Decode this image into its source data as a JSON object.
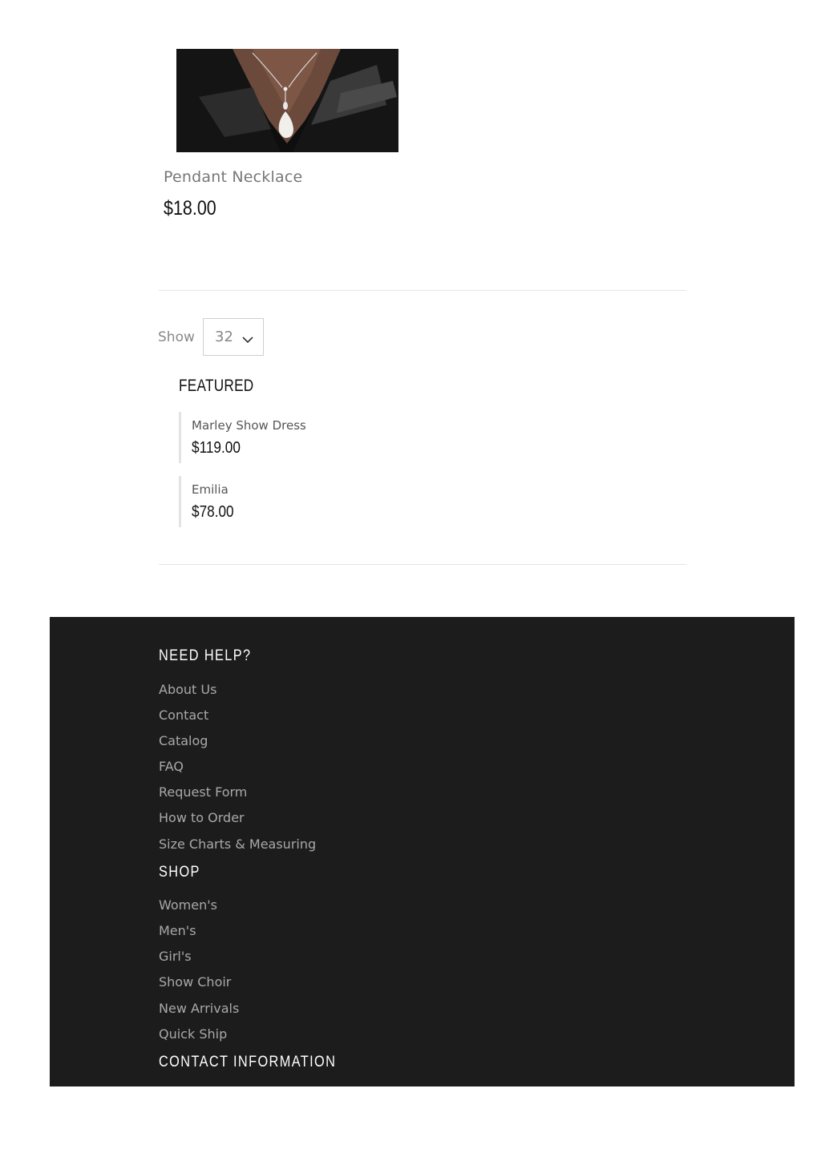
{
  "product": {
    "name": "Pendant Necklace",
    "price": "$18.00",
    "image": "necklace-photo"
  },
  "pagination": {
    "show_label": "Show",
    "per_page": "32"
  },
  "featured": {
    "title": "FEATURED",
    "items": [
      {
        "name": "Marley Show Dress",
        "price": "$119.00"
      },
      {
        "name": "Emilia",
        "price": "$78.00"
      }
    ]
  },
  "footer": {
    "need_help": {
      "title": "NEED HELP?",
      "links": [
        "About Us",
        "Contact",
        "Catalog",
        "FAQ",
        "Request Form",
        "How to Order",
        "Size Charts & Measuring"
      ]
    },
    "shop": {
      "title": "SHOP",
      "links": [
        "Women's",
        "Men's",
        "Girl's",
        "Show Choir",
        "New Arrivals",
        "Quick Ship"
      ]
    },
    "contact": {
      "title": "CONTACT INFORMATION"
    },
    "background": "#1c1c1c"
  }
}
